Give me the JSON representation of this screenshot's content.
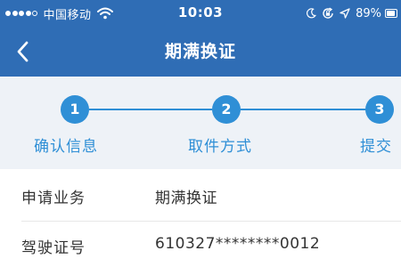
{
  "status_bar": {
    "carrier": "中国移动",
    "time": "10:03",
    "battery": "89%",
    "battery_level": 0.89,
    "signal_bars": 5,
    "signal_filled": 4,
    "icons": [
      "signal-icon",
      "wifi-icon",
      "moon-icon",
      "rotation-lock-icon",
      "location-arrow-icon",
      "battery-icon"
    ]
  },
  "nav": {
    "title": "期满换证",
    "back_icon": "chevron-left-icon"
  },
  "steps": [
    {
      "number": "1",
      "label": "确认信息"
    },
    {
      "number": "2",
      "label": "取件方式"
    },
    {
      "number": "3",
      "label": "提交"
    }
  ],
  "details": [
    {
      "label": "申请业务",
      "value": "期满换证"
    },
    {
      "label": "驾驶证号",
      "value": "610327********0012"
    }
  ],
  "colors": {
    "header": "#2f6db5",
    "accent": "#2f8fd6",
    "stepper_bg": "#eef2f7",
    "text": "#333333"
  }
}
